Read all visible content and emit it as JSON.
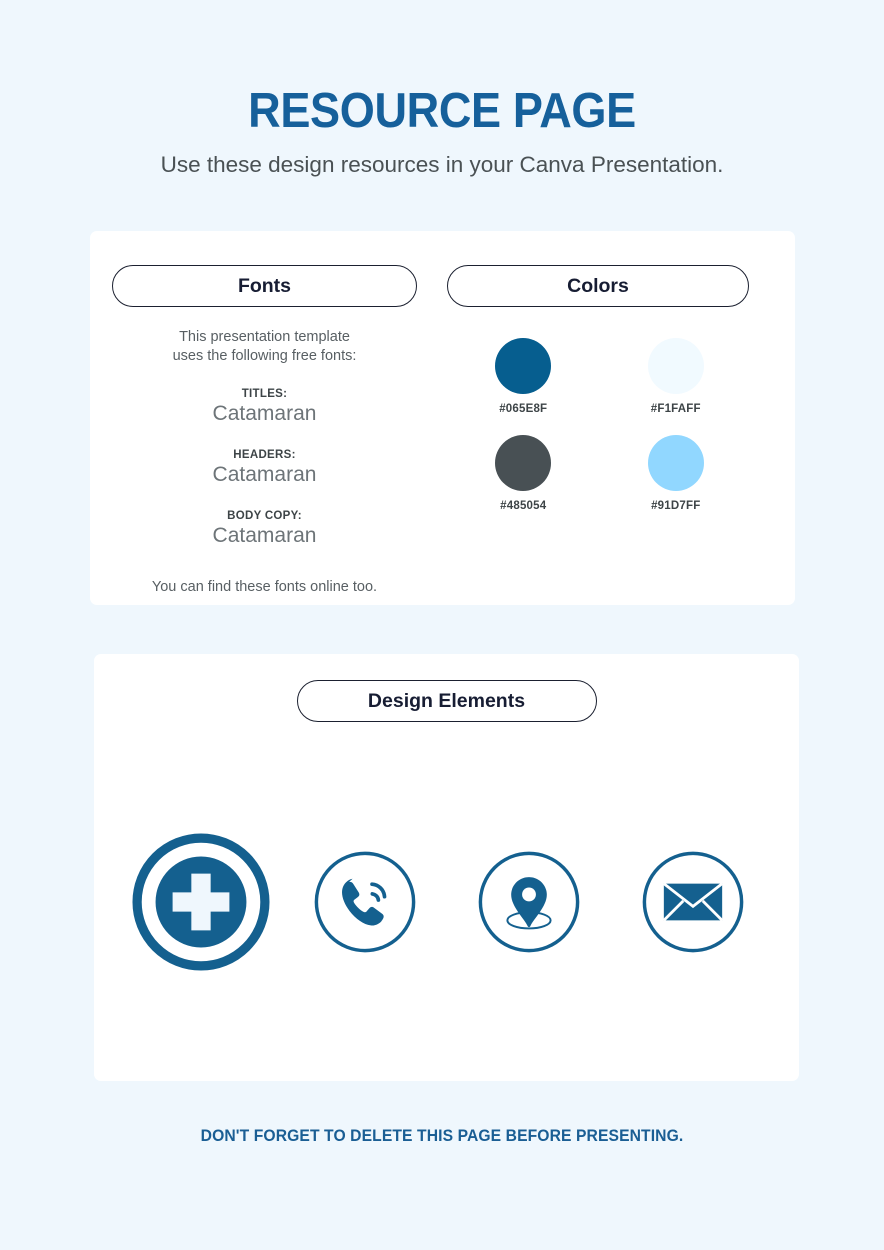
{
  "page": {
    "background_color": "#EFF7FD",
    "title": "RESOURCE PAGE",
    "subtitle": "Use these design resources in your Canva Presentation.",
    "title_color": "#16609B",
    "footer_note": "DON'T FORGET TO DELETE THIS PAGE BEFORE PRESENTING."
  },
  "fonts_panel": {
    "heading": "Fonts",
    "intro_line_1": "This presentation template",
    "intro_line_2": "uses the following free fonts:",
    "groups": [
      {
        "label": "TITLES:",
        "value": "Catamaran"
      },
      {
        "label": "HEADERS:",
        "value": "Catamaran"
      },
      {
        "label": "BODY COPY:",
        "value": "Catamaran"
      }
    ],
    "outro": "You can find these fonts online too."
  },
  "colors_panel": {
    "heading": "Colors",
    "swatches": [
      {
        "hex": "#065E8F",
        "label": "#065E8F"
      },
      {
        "hex": "#F1FAFF",
        "label": "#F1FAFF"
      },
      {
        "hex": "#485054",
        "label": "#485054"
      },
      {
        "hex": "#91D7FF",
        "label": "#91D7FF"
      }
    ]
  },
  "design_elements_panel": {
    "heading": "Design Elements",
    "icon_color": "#14608F",
    "icons": [
      {
        "name": "medical-cross-icon"
      },
      {
        "name": "phone-call-icon"
      },
      {
        "name": "location-pin-icon"
      },
      {
        "name": "envelope-mail-icon"
      }
    ]
  }
}
